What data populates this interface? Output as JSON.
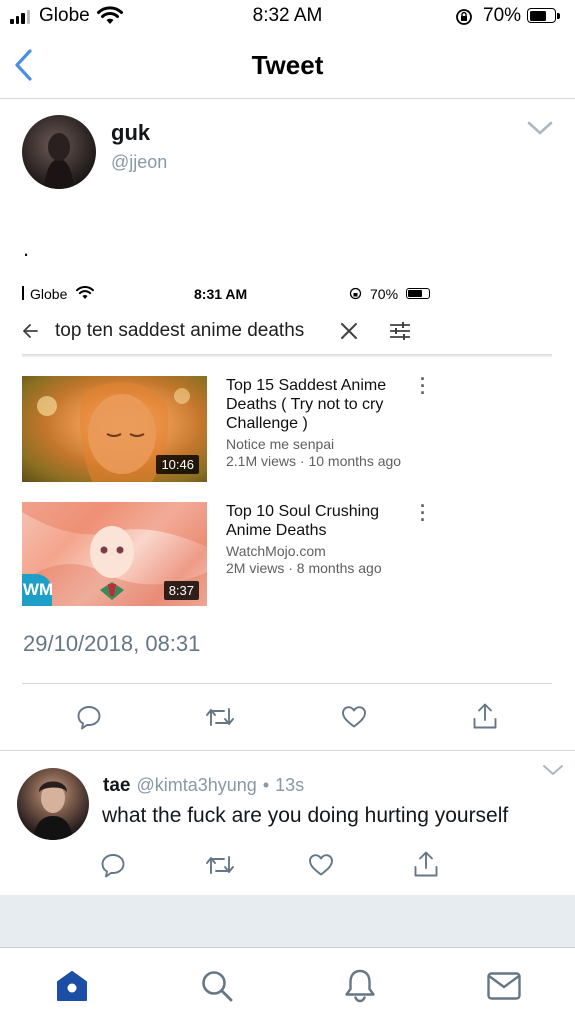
{
  "status_bar": {
    "carrier": "Globe",
    "time": "8:32 AM",
    "battery": "70%",
    "battery_level": 0.7
  },
  "nav": {
    "title": "Tweet",
    "back_icon": "chevron-left-icon"
  },
  "tweet": {
    "name": "guk",
    "handle": "@jjeon",
    "text": ".",
    "timestamp": "29/10/2018, 08:31",
    "embedded_screenshot": {
      "status": {
        "carrier": "Globe",
        "time": "8:31 AM",
        "battery": "70%"
      },
      "search_query": "top ten saddest anime deaths",
      "results": [
        {
          "title_line1": "Top 15 Saddest Anime",
          "title_line2": "Deaths ( Try not to cry",
          "title_line3": "Challenge )",
          "channel": "Notice me  senpai",
          "meta": "2.1M views · 10 months ago",
          "duration": "10:46"
        },
        {
          "title_line1": "Top 10 Soul Crushing",
          "title_line2": "Anime Deaths",
          "channel": "WatchMojo.com",
          "meta": "2M views · 8 months ago",
          "duration": "8:37",
          "badge": "WM"
        }
      ]
    },
    "actions": [
      "reply-icon",
      "retweet-icon",
      "like-icon",
      "share-icon"
    ]
  },
  "reply": {
    "name": "tae",
    "handle": "@kimta3hyung",
    "age": "13s",
    "separator": "•",
    "text": "what the fuck are you doing hurting yourself"
  },
  "tab_bar": [
    "home-icon",
    "search-icon",
    "notifications-icon",
    "messages-icon"
  ],
  "colors": {
    "accent": "#4a90e2",
    "home_active": "#1d4ea6",
    "icon_gray": "#657786"
  }
}
